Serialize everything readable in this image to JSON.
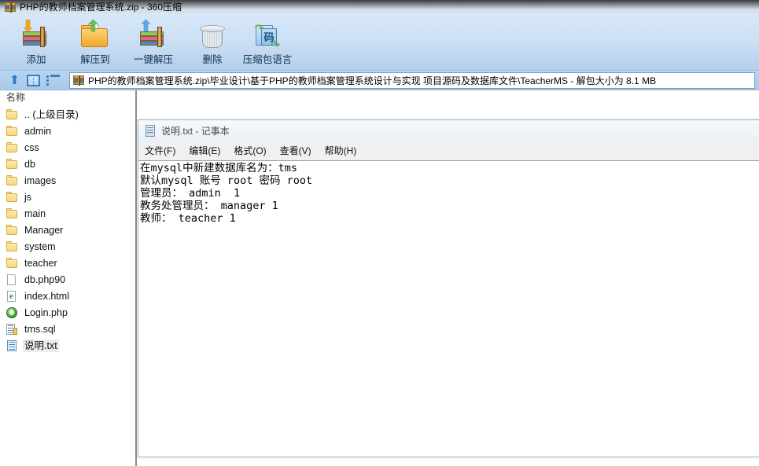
{
  "window": {
    "title": "PHP的教师档案管理系统.zip - 360压缩",
    "app_icon": "zip-archive-icon"
  },
  "toolbar": {
    "buttons": [
      {
        "label": "添加",
        "icon": "add-to-archive-icon"
      },
      {
        "label": "解压到",
        "icon": "extract-to-folder-icon"
      },
      {
        "label": "一键解压",
        "icon": "one-click-extract-icon"
      },
      {
        "label": "删除",
        "icon": "trash-delete-icon"
      },
      {
        "label": "压缩包语言",
        "icon": "archive-language-icon"
      }
    ]
  },
  "pathbar": {
    "nav_up_icon": "up-arrow-icon",
    "preview_panel_icon": "preview-panel-icon",
    "list_view_icon": "list-view-icon",
    "path_icon": "zip-archive-icon",
    "path": "PHP的教师档案管理系统.zip\\毕业设计\\基于PHP的教师档案管理系统设计与实现 项目源码及数据库文件\\TeacherMS - 解包大小为 8.1 MB"
  },
  "filelist": {
    "column_header": "名称",
    "rows": [
      {
        "name": ".. (上级目录)",
        "icon": "folder-icon",
        "type": "folder",
        "selected": false
      },
      {
        "name": "admin",
        "icon": "folder-icon",
        "type": "folder",
        "selected": false
      },
      {
        "name": "css",
        "icon": "folder-icon",
        "type": "folder",
        "selected": false
      },
      {
        "name": "db",
        "icon": "folder-icon",
        "type": "folder",
        "selected": false
      },
      {
        "name": "images",
        "icon": "folder-icon",
        "type": "folder",
        "selected": false
      },
      {
        "name": "js",
        "icon": "folder-icon",
        "type": "folder",
        "selected": false
      },
      {
        "name": "main",
        "icon": "folder-icon",
        "type": "folder",
        "selected": false
      },
      {
        "name": "Manager",
        "icon": "folder-icon",
        "type": "folder",
        "selected": false
      },
      {
        "name": "system",
        "icon": "folder-icon",
        "type": "folder",
        "selected": false
      },
      {
        "name": "teacher",
        "icon": "folder-icon",
        "type": "folder",
        "selected": false
      },
      {
        "name": "db.php90",
        "icon": "document-icon",
        "type": "doc",
        "selected": false
      },
      {
        "name": "index.html",
        "icon": "internet-explorer-icon",
        "type": "ie",
        "selected": false
      },
      {
        "name": "Login.php",
        "icon": "php-file-icon",
        "type": "php",
        "selected": false
      },
      {
        "name": "tms.sql",
        "icon": "sql-file-icon",
        "type": "sql",
        "selected": false
      },
      {
        "name": "说明.txt",
        "icon": "text-file-icon",
        "type": "txt",
        "selected": true
      }
    ]
  },
  "notepad": {
    "title": "说明.txt - 记事本",
    "title_icon": "notepad-icon",
    "menu": [
      "文件(F)",
      "编辑(E)",
      "格式(O)",
      "查看(V)",
      "帮助(H)"
    ],
    "text_lines": [
      "在mysql中新建数据库名为：tms",
      "默认mysql 账号 root 密码 root",
      "管理员： admin  1",
      "教务处管理员： manager 1",
      "教师： teacher 1"
    ]
  },
  "colors": {
    "titlebar_accent": "#dce7f4",
    "toolbar_bg": "#cde0f4",
    "pathbar_bg": "#a8c9e9",
    "selection": "#ececec",
    "splitter": "#8c8c8c"
  }
}
